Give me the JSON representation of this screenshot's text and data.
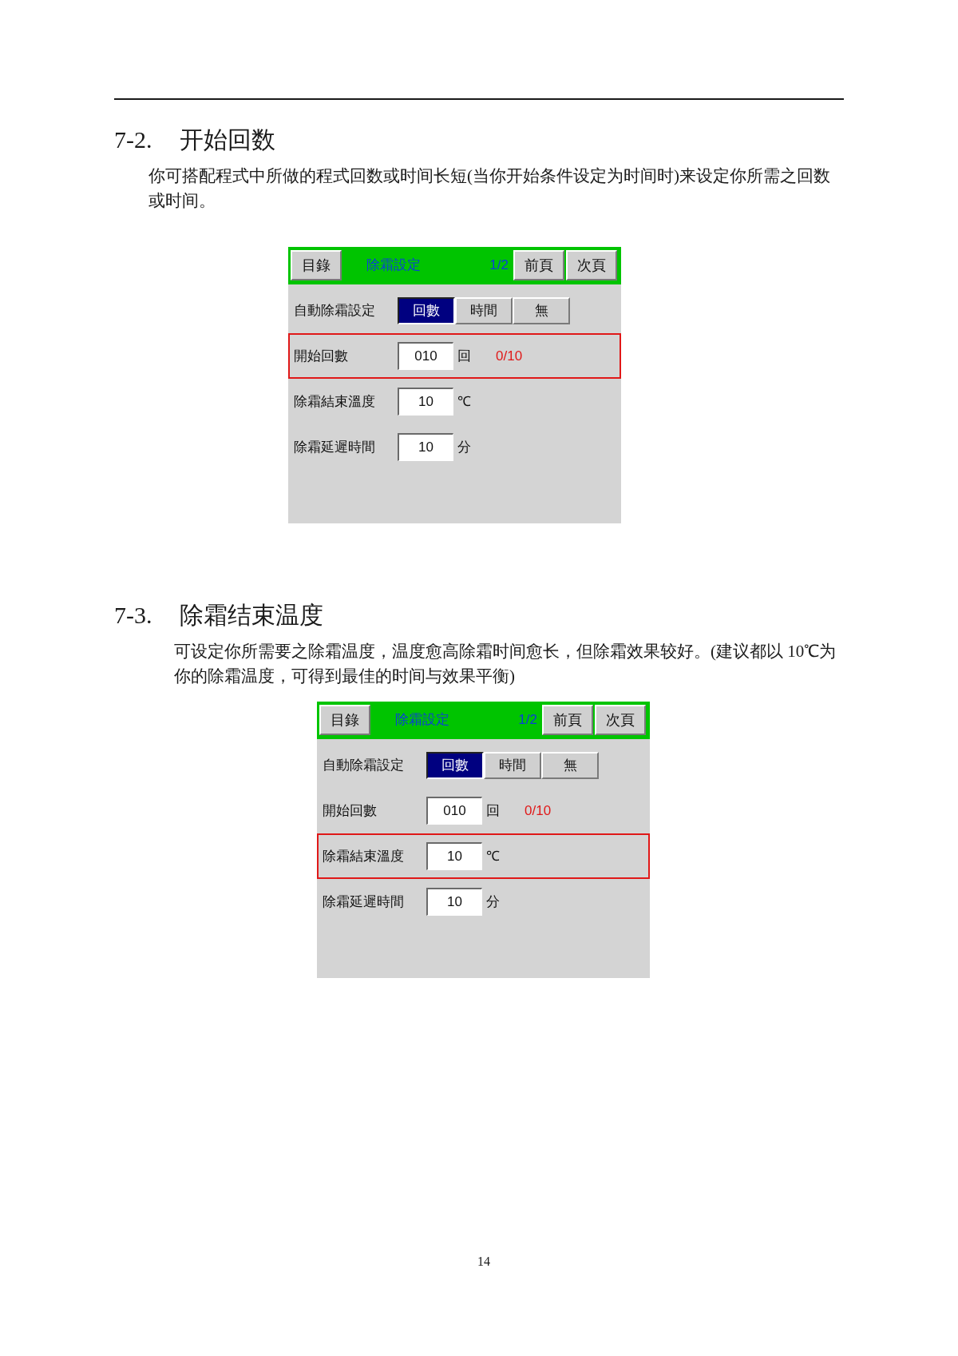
{
  "sections": [
    {
      "number": "7-2.",
      "title": "开始回数",
      "body": "你可搭配程式中所做的程式回数或时间长短(当你开始条件设定为时间时)来设定你所需之回数或时间。",
      "panel": {
        "header": {
          "menu_button": "目錄",
          "title": "除霜設定",
          "page_indicator": "1/2",
          "nav_buttons": [
            "前頁",
            "次頁"
          ]
        },
        "rows": [
          {
            "kind": "segmented",
            "label": "自動除霜設定",
            "highlighted": false,
            "options": [
              {
                "label": "回數",
                "selected": true
              },
              {
                "label": "時間",
                "selected": false
              },
              {
                "label": "無",
                "selected": false
              }
            ]
          },
          {
            "kind": "input",
            "label": "開始回數",
            "highlighted": true,
            "value": "010",
            "unit": "回",
            "note": "0/10"
          },
          {
            "kind": "input",
            "label": "除霜結束溫度",
            "highlighted": false,
            "value": "10",
            "unit": "℃"
          },
          {
            "kind": "input",
            "label": "除霜延遲時間",
            "highlighted": false,
            "value": "10",
            "unit": "分"
          }
        ]
      }
    },
    {
      "number": "7-3.",
      "title": "除霜结束温度",
      "body": "可设定你所需要之除霜温度，温度愈高除霜时间愈长，但除霜效果较好。(建议都以 10℃为你的除霜温度，可得到最佳的时间与效果平衡)",
      "panel": {
        "header": {
          "menu_button": "目錄",
          "title": "除霜設定",
          "page_indicator": "1/2",
          "nav_buttons": [
            "前頁",
            "次頁"
          ]
        },
        "rows": [
          {
            "kind": "segmented",
            "label": "自動除霜設定",
            "highlighted": false,
            "options": [
              {
                "label": "回數",
                "selected": true
              },
              {
                "label": "時間",
                "selected": false
              },
              {
                "label": "無",
                "selected": false
              }
            ]
          },
          {
            "kind": "input",
            "label": "開始回數",
            "highlighted": false,
            "value": "010",
            "unit": "回",
            "note": "0/10"
          },
          {
            "kind": "input",
            "label": "除霜結束溫度",
            "highlighted": true,
            "value": "10",
            "unit": "℃"
          },
          {
            "kind": "input",
            "label": "除霜延遲時間",
            "highlighted": false,
            "value": "10",
            "unit": "分"
          }
        ]
      }
    }
  ],
  "page_number": "14"
}
